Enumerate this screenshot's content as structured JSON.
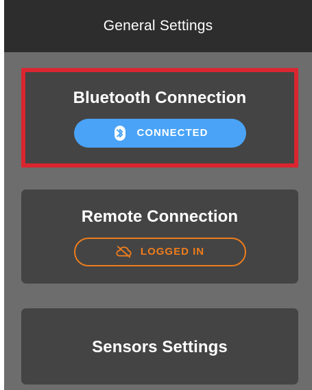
{
  "header": {
    "title": "General Settings"
  },
  "cards": {
    "bluetooth": {
      "title": "Bluetooth Connection",
      "status": "CONNECTED",
      "status_color": "#4aa3f7",
      "icon": "bluetooth-icon"
    },
    "remote": {
      "title": "Remote Connection",
      "status": "LOGGED IN",
      "status_color": "#ef7d1c",
      "icon": "cloud-off-icon"
    },
    "sensors": {
      "title": "Sensors Settings"
    }
  },
  "colors": {
    "header_bg": "#2d2d2d",
    "content_bg": "#6d6d6d",
    "card_bg": "#444444",
    "highlight_border": "#d92630"
  }
}
